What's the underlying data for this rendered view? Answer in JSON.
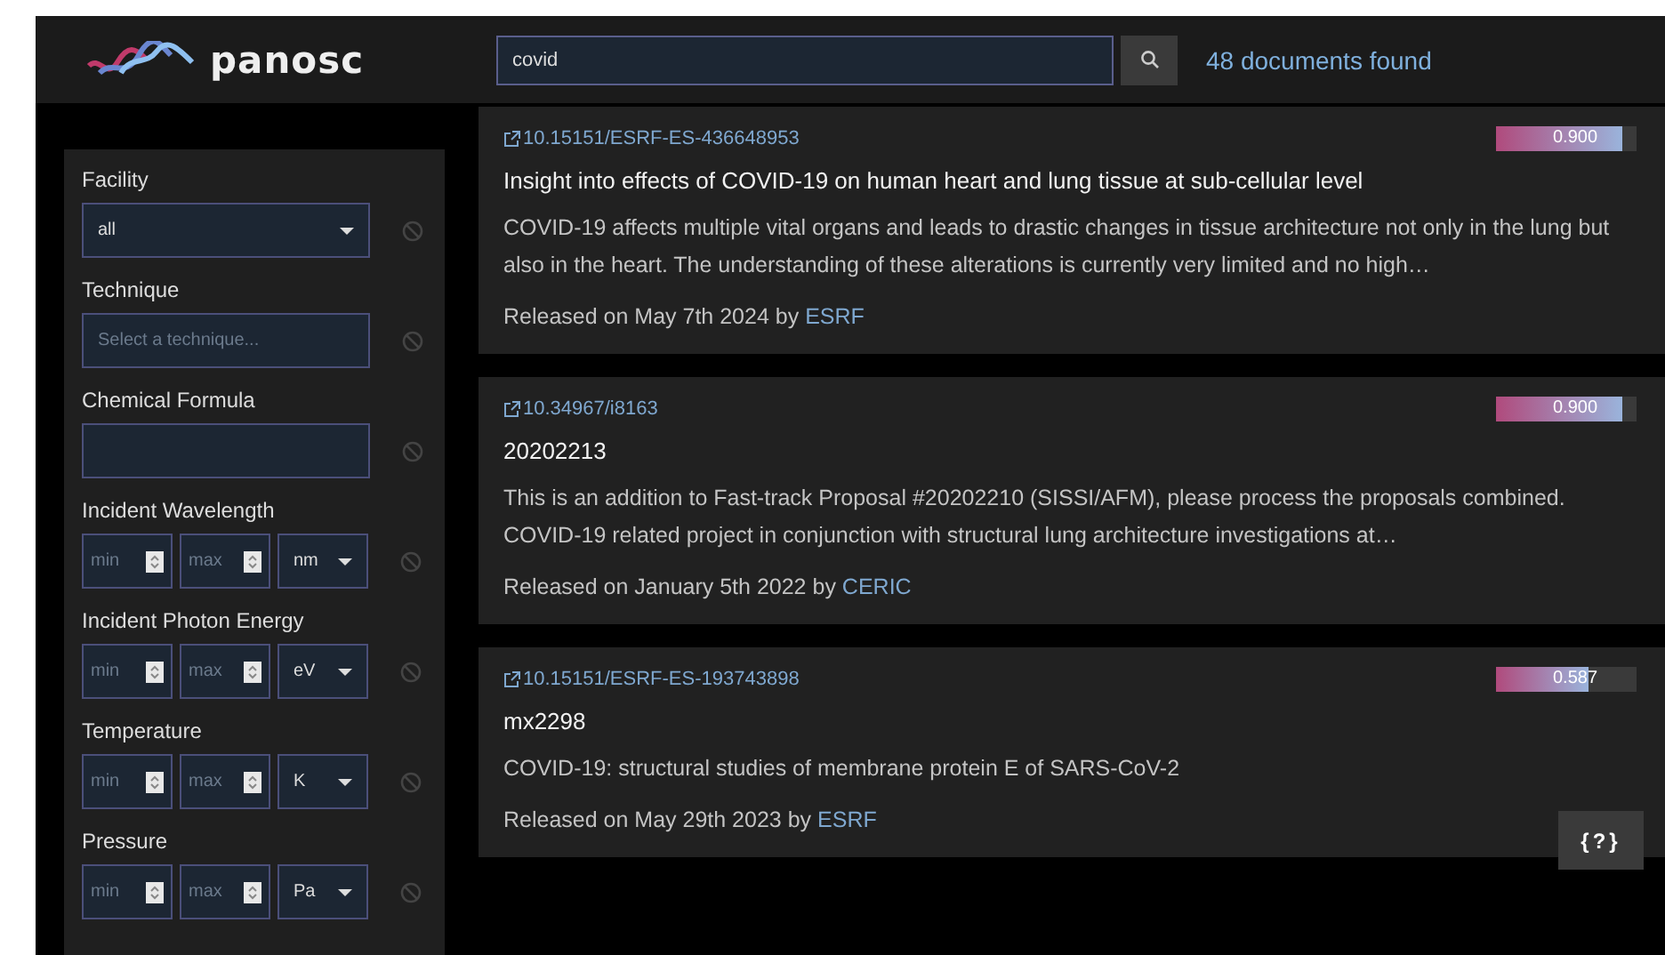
{
  "header": {
    "brand": "panosc",
    "search": {
      "value": "covid"
    },
    "results_count": "48",
    "results_label": "documents found"
  },
  "filters": [
    {
      "kind": "select",
      "label": "Facility",
      "value": "all"
    },
    {
      "kind": "text",
      "label": "Technique",
      "placeholder": "Select a technique..."
    },
    {
      "kind": "text",
      "label": "Chemical Formula"
    },
    {
      "kind": "range",
      "label": "Incident Wavelength",
      "min": "min",
      "max": "max",
      "unit": "nm"
    },
    {
      "kind": "range",
      "label": "Incident Photon Energy",
      "min": "min",
      "max": "max",
      "unit": "eV"
    },
    {
      "kind": "range",
      "label": "Temperature",
      "min": "min",
      "max": "max",
      "unit": "K"
    },
    {
      "kind": "range",
      "label": "Pressure",
      "min": "min",
      "max": "max",
      "unit": "Pa"
    }
  ],
  "results": [
    {
      "doi": "10.15151/ESRF-ES-436648953",
      "score": "0.900",
      "level": 0.9,
      "title": "Insight into effects of COVID-19 on human heart and lung tissue at sub-cellular level",
      "description": "COVID-19 affects multiple vital organs and leads to drastic changes in tissue architecture not only in the lung but also in the heart. The understanding of these alterations is currently very limited and no high…",
      "released": "Released on May 7th 2024 by",
      "facility": "ESRF"
    },
    {
      "doi": "10.34967/i8163",
      "score": "0.900",
      "level": 0.9,
      "title": "20202213",
      "description": "This is an addition to Fast-track Proposal #20202210 (SISSI/AFM), please process the proposals combined. COVID-19 related project in conjunction with structural lung architecture investigations at…",
      "released": "Released on January 5th 2022 by",
      "facility": "CERIC"
    },
    {
      "doi": "10.15151/ESRF-ES-193743898",
      "score": "0.587",
      "level": 0.66,
      "title": "mx2298",
      "description": "COVID-19: structural studies of membrane protein E of SARS-CoV-2",
      "released": "Released on May 29th 2023 by",
      "facility": "ESRF"
    }
  ],
  "help_button": "{?}"
}
